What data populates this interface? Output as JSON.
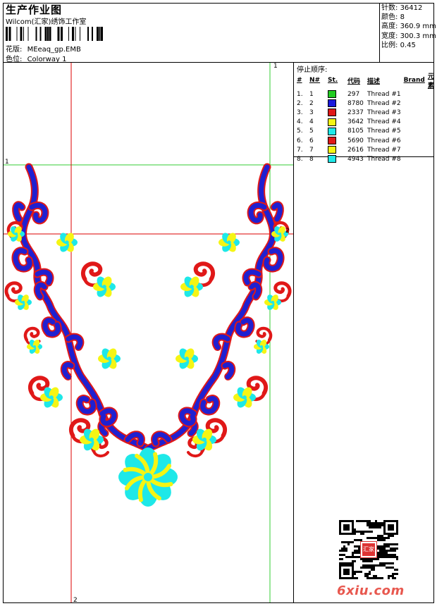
{
  "header": {
    "title": "生产作业图",
    "subtitle": "Wilcom(汇家)绣饰工作室",
    "pattern_label": "花版:",
    "pattern_value": "MEeaq_gp.EMB",
    "colorway_label": "色位:",
    "colorway_value": "Colorway 1"
  },
  "stats": [
    {
      "label": "针数:",
      "value": "36412"
    },
    {
      "label": "颜色:",
      "value": "8"
    },
    {
      "label": "高度:",
      "value": "360.9 mm"
    },
    {
      "label": "宽度:",
      "value": "300.3 mm"
    },
    {
      "label": "比例:",
      "value": "0.45"
    }
  ],
  "stop_sequence": {
    "title": "停止顺序:",
    "columns": [
      "#",
      "N#",
      "St.",
      "代码",
      "描述",
      "Brand",
      "元素"
    ],
    "rows": [
      {
        "idx": "1.",
        "n": "1",
        "code": "297",
        "desc": "Thread #1",
        "color": "#22cc22"
      },
      {
        "idx": "2.",
        "n": "2",
        "code": "8780",
        "desc": "Thread #2",
        "color": "#1a1adc"
      },
      {
        "idx": "3.",
        "n": "3",
        "code": "2337",
        "desc": "Thread #3",
        "color": "#e01818"
      },
      {
        "idx": "4.",
        "n": "4",
        "code": "3642",
        "desc": "Thread #4",
        "color": "#f5f514"
      },
      {
        "idx": "5.",
        "n": "5",
        "code": "8105",
        "desc": "Thread #5",
        "color": "#1ee8e8"
      },
      {
        "idx": "6.",
        "n": "6",
        "code": "5690",
        "desc": "Thread #6",
        "color": "#e01818"
      },
      {
        "idx": "7.",
        "n": "7",
        "code": "2616",
        "desc": "Thread #7",
        "color": "#f5f514"
      },
      {
        "idx": "8.",
        "n": "8",
        "code": "4943",
        "desc": "Thread #8",
        "color": "#1ee8e8"
      }
    ]
  },
  "guides": {
    "green_top": "1",
    "green_left": "1",
    "red_right": "2",
    "red_bottom": "2"
  },
  "colors": {
    "blue": "#2020d0",
    "red": "#e01818",
    "cyan": "#1ee8e8",
    "yellow": "#f5f514",
    "guide_green": "#33cc33",
    "guide_red": "#dd0000"
  },
  "watermark": "6xiu.com",
  "qr_seal": "汇家"
}
